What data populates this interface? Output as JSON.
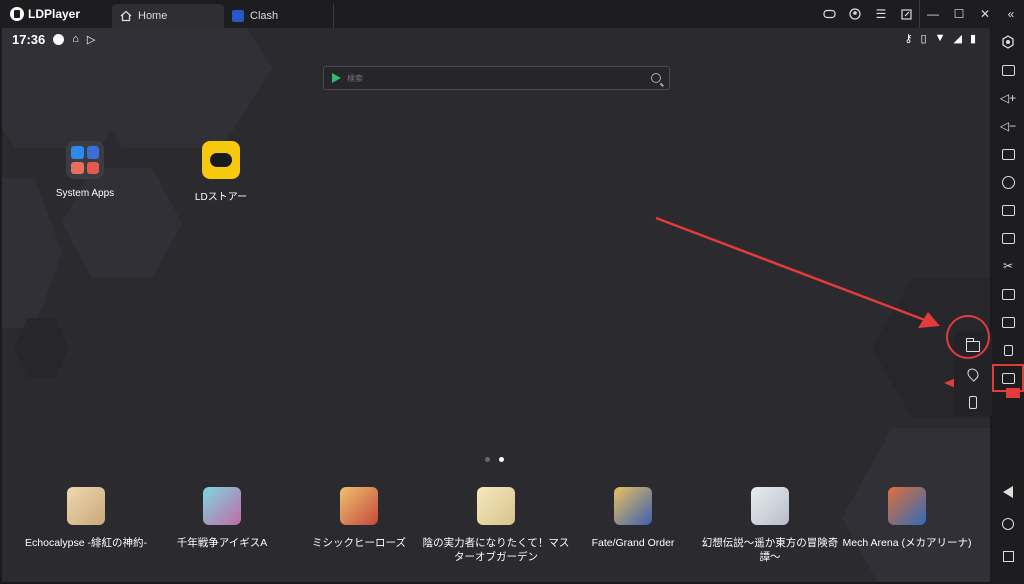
{
  "titlebar": {
    "app_name": "LDPlayer",
    "tabs": [
      {
        "label": "Home",
        "active": true
      },
      {
        "label": "Clash",
        "active": false
      }
    ],
    "controls": [
      "gamepad-icon",
      "account-icon",
      "menu-icon",
      "restore-icon",
      "minimize-icon",
      "maximize-icon",
      "close-icon"
    ],
    "collapse_icon": "double-chevron-left-icon"
  },
  "statusbar": {
    "time": "17:36",
    "left_icons": [
      "dot-icon",
      "clean-icon",
      "play-store-icon"
    ],
    "right_icons": [
      "key-icon",
      "vibrate-icon",
      "wifi-icon",
      "signal-icon",
      "battery-icon"
    ]
  },
  "search": {
    "placeholder": "検索"
  },
  "desktop_apps": [
    {
      "label": "System Apps"
    },
    {
      "label": "LDストアー"
    }
  ],
  "dock_apps": [
    {
      "label": "Echocalypse -緋紅の神約-",
      "color": "#c9a77a"
    },
    {
      "label": "千年戦争アイギスA",
      "color": "#c06aa6"
    },
    {
      "label": "ミシックヒーローズ",
      "color": "#c24a3a"
    },
    {
      "label": "陰の実力者になりたくて！マスターオブガーデン",
      "color": "#d8c28a"
    },
    {
      "label": "Fate/Grand Order",
      "color": "#3d5fb0"
    },
    {
      "label": "幻想伝説〜遥か東方の冒険奇譚〜",
      "color": "#b9bdc8"
    },
    {
      "label": "Mech Arena (メカアリーナ)",
      "color": "#2f6bb8"
    }
  ],
  "page_indicator": {
    "pages": 2,
    "current": 2
  },
  "popup_menu": [
    "folder-icon",
    "location-icon",
    "shake-icon"
  ],
  "toolbar": {
    "items": [
      "settings-icon",
      "keyboard-icon",
      "volume-up-icon",
      "volume-down-icon",
      "screenshot-icon",
      "auto-icon",
      "add-app-icon",
      "apk-icon",
      "scissors-icon",
      "video-icon",
      "sync-icon",
      "shake-icon",
      "more-icon"
    ],
    "nav": [
      "back-icon",
      "home-icon",
      "recents-icon"
    ]
  },
  "colors": {
    "accent": "#e23b3b",
    "store_yellow": "#f6c90e",
    "background": "#2a2a2f"
  }
}
